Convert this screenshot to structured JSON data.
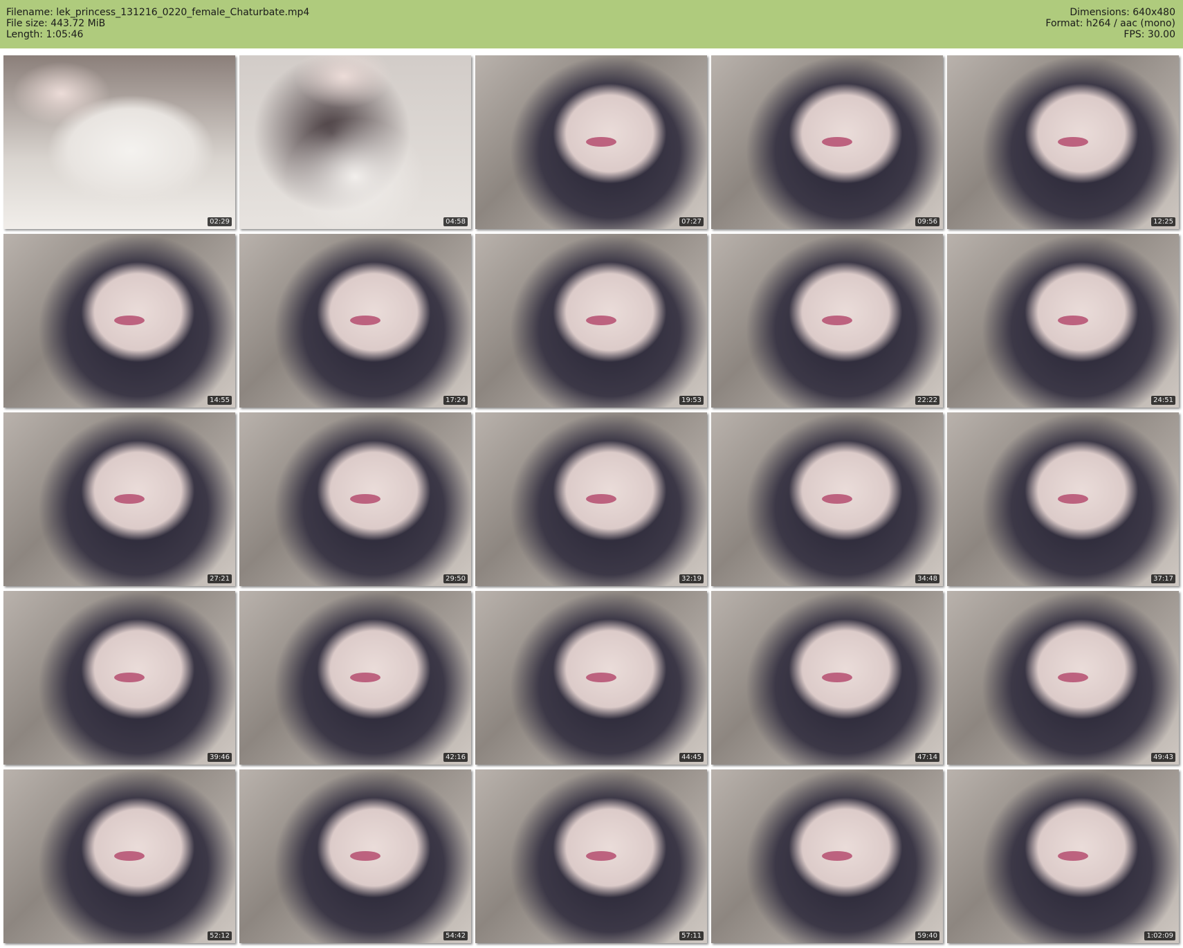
{
  "header": {
    "filename_label": "Filename: lek_princess_131216_0220_female_Chaturbate.mp4",
    "filesize_label": "File size: 443.72 MiB",
    "length_label": "Length: 1:05:46",
    "dimensions_label": "Dimensions: 640x480",
    "format_label": "Format: h264 / aac (mono)",
    "fps_label": "FPS: 30.00"
  },
  "colors": {
    "header_bg": "#afcb7d",
    "page_bg": "#ffffff",
    "lip_accent": "#b54e70"
  },
  "thumbnails": [
    {
      "timestamp": "02:29"
    },
    {
      "timestamp": "04:58"
    },
    {
      "timestamp": "07:27"
    },
    {
      "timestamp": "09:56"
    },
    {
      "timestamp": "12:25"
    },
    {
      "timestamp": "14:55"
    },
    {
      "timestamp": "17:24"
    },
    {
      "timestamp": "19:53"
    },
    {
      "timestamp": "22:22"
    },
    {
      "timestamp": "24:51"
    },
    {
      "timestamp": "27:21"
    },
    {
      "timestamp": "29:50"
    },
    {
      "timestamp": "32:19"
    },
    {
      "timestamp": "34:48"
    },
    {
      "timestamp": "37:17"
    },
    {
      "timestamp": "39:46"
    },
    {
      "timestamp": "42:16"
    },
    {
      "timestamp": "44:45"
    },
    {
      "timestamp": "47:14"
    },
    {
      "timestamp": "49:43"
    },
    {
      "timestamp": "52:12"
    },
    {
      "timestamp": "54:42"
    },
    {
      "timestamp": "57:11"
    },
    {
      "timestamp": "59:40"
    },
    {
      "timestamp": "1:02:09"
    }
  ]
}
